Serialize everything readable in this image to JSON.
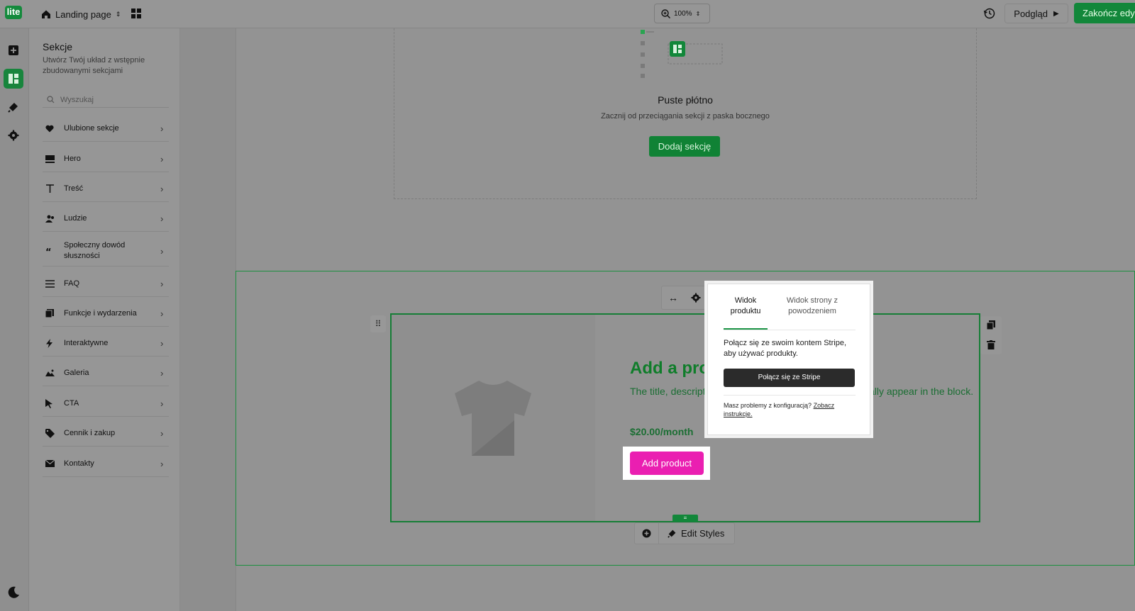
{
  "topbar": {
    "logo": "lite",
    "page_name": "Landing page",
    "zoom": "100%",
    "preview_label": "Podgląd",
    "finish_label": "Zakończ edy"
  },
  "panel": {
    "title": "Sekcje",
    "subtitle": "Utwórz Twój układ z wstępnie zbudowanymi sekcjami",
    "search_placeholder": "Wyszukaj",
    "items": [
      {
        "label": "Ulubione sekcje",
        "icon": "heart-icon"
      },
      {
        "label": "Hero",
        "icon": "hero-icon"
      },
      {
        "label": "Treść",
        "icon": "text-icon"
      },
      {
        "label": "Ludzie",
        "icon": "people-icon"
      },
      {
        "label": "Społeczny dowód słuszności",
        "icon": "quote-icon"
      },
      {
        "label": "FAQ",
        "icon": "list-icon"
      },
      {
        "label": "Funkcje i wydarzenia",
        "icon": "features-icon"
      },
      {
        "label": "Interaktywne",
        "icon": "bolt-icon"
      },
      {
        "label": "Galeria",
        "icon": "image-icon"
      },
      {
        "label": "CTA",
        "icon": "cursor-icon"
      },
      {
        "label": "Cennik i zakup",
        "icon": "tag-icon"
      },
      {
        "label": "Kontakty",
        "icon": "mail-icon"
      }
    ]
  },
  "empty_canvas": {
    "title": "Puste płótno",
    "subtitle": "Zacznij od przeciągania sekcji z paska bocznego",
    "button": "Dodaj sekcję"
  },
  "product_block": {
    "title": "Add a pro",
    "desc_left": "The title, descript",
    "desc_right": "cally appear in the block.",
    "price": "$20.00/month",
    "button": "Add product",
    "edit_styles": "Edit Styles"
  },
  "popup": {
    "tab_product": "Widok produktu",
    "tab_success": "Widok strony z powodzeniem",
    "text": "Połącz się ze swoim kontem Stripe, aby używać produkty.",
    "stripe_button": "Połącz się ze Stripe",
    "help_prefix": "Masz problemy z konfiguracją?",
    "help_link": "Zobacz instrukcje."
  },
  "colors": {
    "brand_green": "#148a3c",
    "product_button": "#ea1fb1",
    "stripe_button": "#2b2b2b"
  }
}
